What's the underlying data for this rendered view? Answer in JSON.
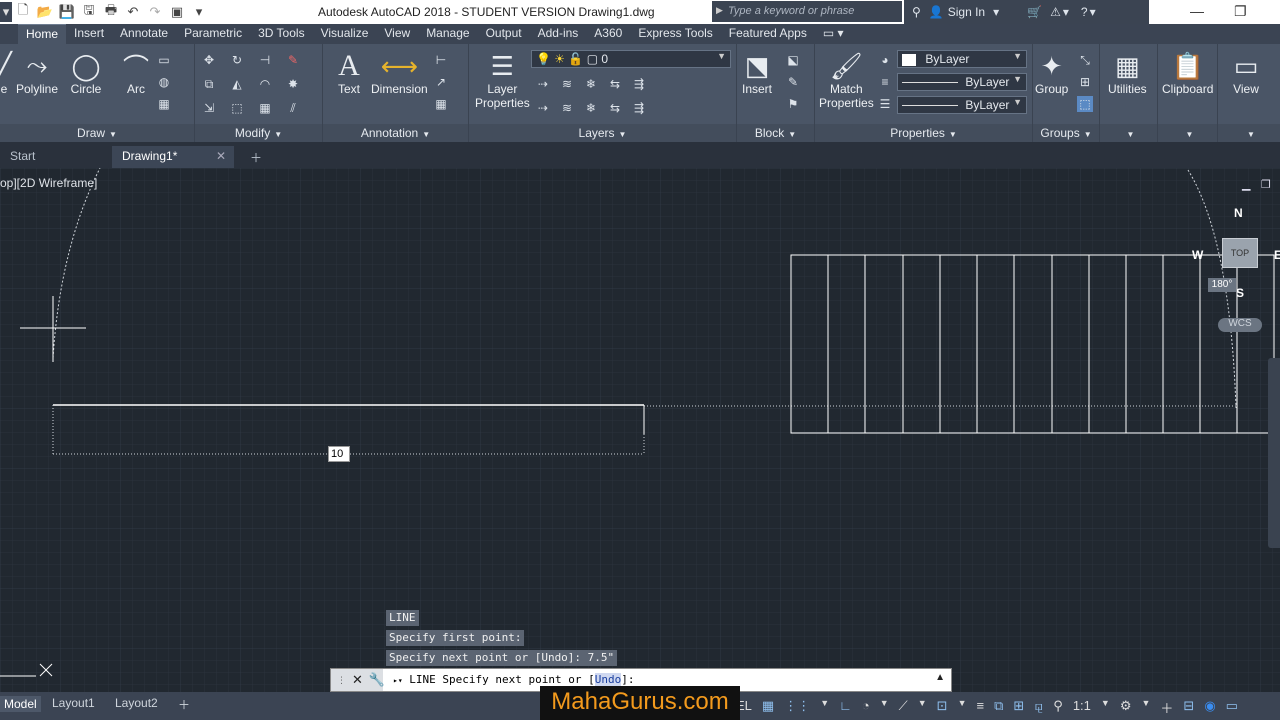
{
  "window": {
    "title": "Autodesk AutoCAD 2018 - STUDENT VERSION    Drawing1.dwg",
    "search_placeholder": "Type a keyword or phrase",
    "sign_in": "Sign In"
  },
  "ribbon_tabs": [
    "Home",
    "Insert",
    "Annotate",
    "Parametric",
    "3D Tools",
    "Visualize",
    "View",
    "Manage",
    "Output",
    "Add-ins",
    "A360",
    "Express Tools",
    "Featured Apps"
  ],
  "ribbon": {
    "draw": {
      "title": "Draw",
      "line": "e",
      "polyline": "Polyline",
      "circle": "Circle",
      "arc": "Arc"
    },
    "modify": {
      "title": "Modify"
    },
    "annotation": {
      "title": "Annotation",
      "text": "Text",
      "dimension": "Dimension"
    },
    "layers": {
      "title": "Layers",
      "layer_properties_1": "Layer",
      "layer_properties_2": "Properties",
      "current_layer": "0"
    },
    "block": {
      "title": "Block",
      "insert": "Insert"
    },
    "properties": {
      "title": "Properties",
      "match_1": "Match",
      "match_2": "Properties",
      "color": "ByLayer",
      "linetype": "ByLayer",
      "lineweight": "ByLayer"
    },
    "groups": {
      "title": "Groups",
      "group": "Group"
    },
    "utilities": "Utilities",
    "clipboard": "Clipboard",
    "view": "View"
  },
  "doc_tabs": {
    "start": "Start",
    "drawing": "Drawing1*"
  },
  "viewport": {
    "label": "op][2D Wireframe]",
    "dynamic_input": "10",
    "viewcube": {
      "n": "N",
      "w": "W",
      "s": "S",
      "e": "E",
      "top": "TOP",
      "angle": "180°",
      "wcs": "WCS"
    }
  },
  "command": {
    "history": [
      "LINE",
      "Specify first point:",
      "Specify next point or [Undo]: 7.5\""
    ],
    "prompt_prefix": "LINE Specify next point or [",
    "prompt_option": "Undo",
    "prompt_suffix": "]:"
  },
  "status": {
    "model": "Model",
    "layout1": "Layout1",
    "layout2": "Layout2",
    "scale": "1:1"
  },
  "watermark": "MahaGurus.com",
  "colors": {
    "accent": "#2b6cb0",
    "canvas": "#212830",
    "ribbon": "#4a5566"
  }
}
